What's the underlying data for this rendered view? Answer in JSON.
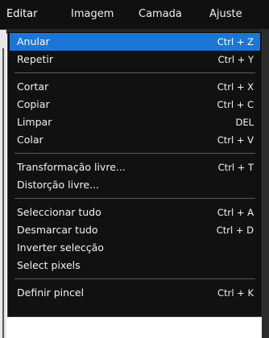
{
  "menubar": {
    "items": [
      {
        "label": "Editar"
      },
      {
        "label": "Imagem"
      },
      {
        "label": "Camada"
      },
      {
        "label": "Ajuste"
      }
    ]
  },
  "menu": {
    "highlight_color": "#1c76d6",
    "groups": [
      [
        {
          "label": "Anular",
          "shortcut": "Ctrl + Z",
          "highlighted": true
        },
        {
          "label": "Repetir",
          "shortcut": "Ctrl + Y"
        }
      ],
      [
        {
          "label": "Cortar",
          "shortcut": "Ctrl + X"
        },
        {
          "label": "Copiar",
          "shortcut": "Ctrl + C"
        },
        {
          "label": "Limpar",
          "shortcut": "DEL"
        },
        {
          "label": "Colar",
          "shortcut": "Ctrl + V"
        }
      ],
      [
        {
          "label": "Transformação livre...",
          "shortcut": "Ctrl + T"
        },
        {
          "label": "Distorção livre...",
          "shortcut": ""
        }
      ],
      [
        {
          "label": "Seleccionar tudo",
          "shortcut": "Ctrl + A"
        },
        {
          "label": "Desmarcar tudo",
          "shortcut": "Ctrl + D"
        },
        {
          "label": "Inverter selecção",
          "shortcut": ""
        },
        {
          "label": "Select pixels",
          "shortcut": ""
        }
      ],
      [
        {
          "label": "Definir pincel",
          "shortcut": "Ctrl + K"
        }
      ]
    ]
  }
}
